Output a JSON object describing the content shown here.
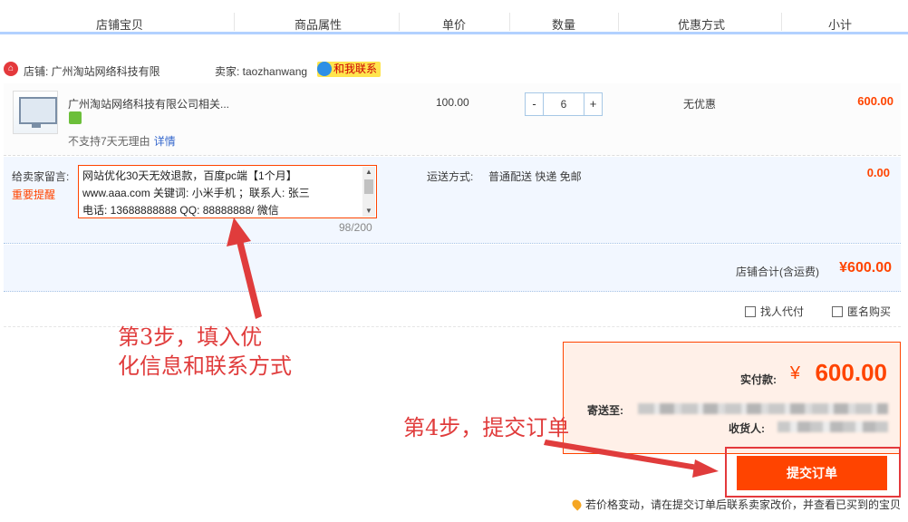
{
  "columns": [
    "店铺宝贝",
    "商品属性",
    "单价",
    "数量",
    "优惠方式",
    "小计"
  ],
  "shop": {
    "icon": "shop-icon",
    "label": "店铺: 广州淘站网络科技有限",
    "seller_label": "卖家: taozhanwang",
    "contact_label": "和我联系"
  },
  "item": {
    "title": "广州淘站网络科技有限公司相关...",
    "return_policy": "不支持7天无理由",
    "detail_link": "详情",
    "unit_price": "100.00",
    "qty_minus": "-",
    "quantity": "6",
    "qty_plus": "+",
    "discount": "无优惠",
    "subtotal": "600.00"
  },
  "message": {
    "label": "给卖家留言:",
    "warning": "重要提醒",
    "lines": [
      "网站优化30天无效退款，百度pc端【1个月】",
      "www.aaa.com  关键词: 小米手机 ；联系人: 张三",
      "电话: 13688888888  QQ: 88888888/ 微信"
    ],
    "count": "98/200"
  },
  "shipping": {
    "label": "运送方式:",
    "value": "普通配送 快递 免邮",
    "fee": "0.00"
  },
  "shop_total": {
    "label": "店铺合计(含运费)",
    "value": "¥600.00"
  },
  "options": {
    "proxy": "找人代付",
    "anonymous": "匿名购买"
  },
  "payment": {
    "label": "实付款:",
    "currency": "¥",
    "value": "600.00",
    "address_label": "寄送至:",
    "receiver_label": "收货人:"
  },
  "submit_label": "提交订单",
  "notice": "若价格变动，请在提交订单后联系卖家改价，并查看已买到的宝贝",
  "annotations": {
    "step3_line1": "第3步，填入优",
    "step3_line2": "化信息和联系方式",
    "step4": "第4步，提交订单"
  },
  "colors": {
    "accent": "#ff4400",
    "annotation": "#e03c3c",
    "header_border": "#b2d1ff"
  }
}
